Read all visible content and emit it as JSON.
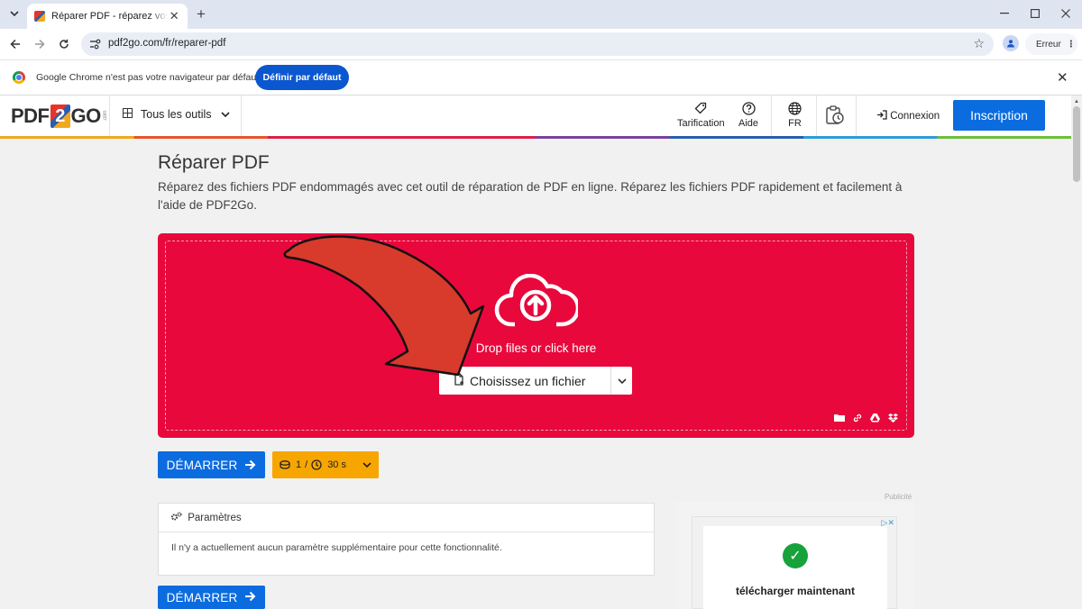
{
  "browser": {
    "tab_title": "Réparer PDF - réparez vos fichiers PDF",
    "url": "pdf2go.com/fr/reparer-pdf",
    "profile_status": "Erreur",
    "infobar_text": "Google Chrome n'est pas votre navigateur par défaut",
    "infobar_button": "Définir par défaut"
  },
  "header": {
    "logo": {
      "pdf": "PDF",
      "two": "2",
      "go": "GO",
      "com": ".com"
    },
    "tools_label": "Tous les outils",
    "pricing_label": "Tarification",
    "help_label": "Aide",
    "language_label": "FR",
    "login_label": "Connexion",
    "signup_label": "Inscription"
  },
  "main": {
    "title": "Réparer PDF",
    "description": "Réparez des fichiers PDF endommagés avec cet outil de réparation de PDF en ligne. Réparez les fichiers PDF rapidement et facilement à l'aide de PDF2Go.",
    "drop_text": "Drop files or click here",
    "choose_label": "Choisissez un fichier",
    "start_label": "DÉMARRER",
    "credits": "1",
    "time": "30 s",
    "params_title": "Paramètres",
    "params_body": "Il n'y a actuellement aucun paramètre supplémentaire pour cette fonctionnalité."
  },
  "ad": {
    "label": "Publicité",
    "text": "télécharger maintenant"
  },
  "colors": {
    "dropzone": "#e8083c",
    "primary": "#0b6ce0",
    "credits": "#f7a600",
    "arrow": "#d83a2c"
  }
}
